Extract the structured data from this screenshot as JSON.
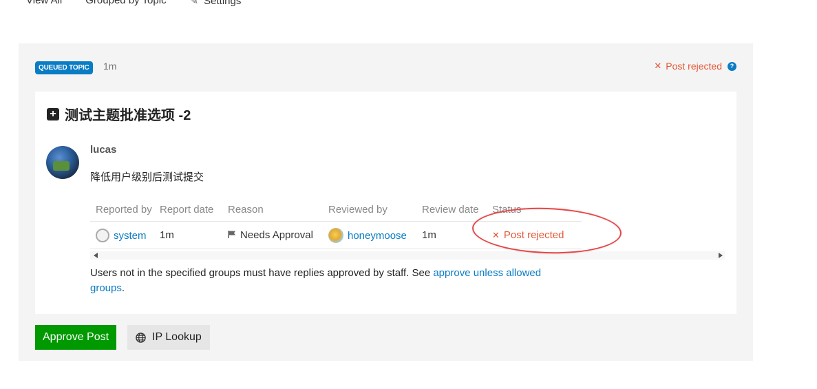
{
  "topnav": {
    "items": [
      "View All",
      "Grouped by Topic",
      "Settings"
    ]
  },
  "review": {
    "badge": "QUEUED TOPIC",
    "age": "1m",
    "status": "Post rejected",
    "help_glyph": "?",
    "title": "测试主题批准选项 -2",
    "username": "lucas",
    "body": "降低用户级别后测试提交",
    "table": {
      "headers": [
        "Reported by",
        "Report date",
        "Reason",
        "Reviewed by",
        "Review date",
        "Status"
      ],
      "row": {
        "reported_by": "system",
        "report_date": "1m",
        "reason": "Needs Approval",
        "reviewed_by": "honeymoose",
        "review_date": "1m",
        "status": "Post rejected"
      }
    },
    "note_prefix": "Users not in the specified groups must have replies approved by staff. See ",
    "note_link": "approve unless allowed groups",
    "note_suffix": ".",
    "approve_label": "Approve Post",
    "ip_label": "IP Lookup"
  },
  "colors": {
    "accent": "#0a7cc4",
    "danger": "#e45735",
    "success": "#009900",
    "annotation": "#e34848"
  },
  "icons": [
    "gear-icon",
    "plus-square-icon",
    "close-icon",
    "help-icon",
    "flag-icon",
    "globe-icon"
  ]
}
